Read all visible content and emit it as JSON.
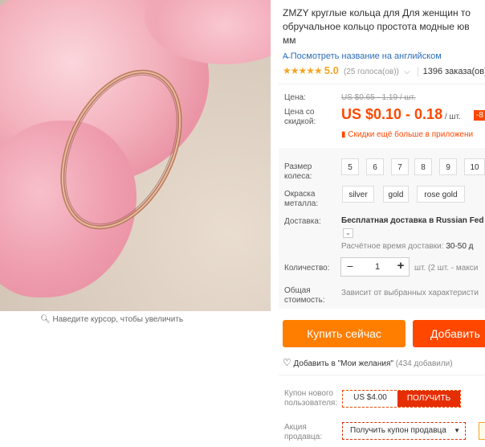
{
  "image": {
    "zoom_hint": "Наведите курсор, чтобы увеличить",
    "zoom_icon": "magnifier-icon"
  },
  "product": {
    "title_lines": [
      "ZMZY круглые кольца для Для женщин то",
      "обручальное кольцо простота модные юв",
      "мм"
    ],
    "translate_link": "Посмотреть название на английском",
    "stars": "★★★★★",
    "rating": "5.0",
    "votes": "(25 голоса(ов))",
    "orders": "1396 заказа(ов)"
  },
  "price": {
    "label": "Цена:",
    "old": "US $0.65 - 1.19 / шт.",
    "discount_label": "Цена со скидкой:",
    "new": "US $0.10 - 0.18",
    "unit": " / шт.",
    "discount_badge": "-8",
    "app_promo": "Скидки ещё больше в приложени"
  },
  "sku": {
    "size_label": "Размер колеса:",
    "sizes": [
      "5",
      "6",
      "7",
      "8",
      "9",
      "10"
    ],
    "color_label": "Окраска металла:",
    "colors": [
      "silver",
      "gold",
      "rose gold"
    ]
  },
  "shipping": {
    "label": "Доставка:",
    "text": "Бесплатная доставка в Russian Fed",
    "time_label": "Расчётное время доставки:",
    "time_value": " 30-50 д"
  },
  "quantity": {
    "label": "Количество:",
    "minus": "−",
    "value": "1",
    "plus": "+",
    "note": "шт. (2 шт. - макси"
  },
  "total": {
    "label": "Общая стоимость:",
    "value": "Зависит от выбранных характеристи"
  },
  "actions": {
    "buy_now": "Купить сейчас",
    "add_to_cart": "Добавить",
    "wishlist": "Добавить в \"Мои желания\"",
    "wishlist_count": "(434 добавили)"
  },
  "coupon": {
    "label": "Купон нового пользователя:",
    "value": "US $4.00",
    "button": "ПОЛУЧИТЬ"
  },
  "promo": {
    "label": "Акция продавца:",
    "select": "Получить купон продавца"
  },
  "colors": {
    "accent": "#ff4700",
    "buy": "#ff7e00",
    "star": "#f5a623",
    "link": "#2a6ebb"
  }
}
